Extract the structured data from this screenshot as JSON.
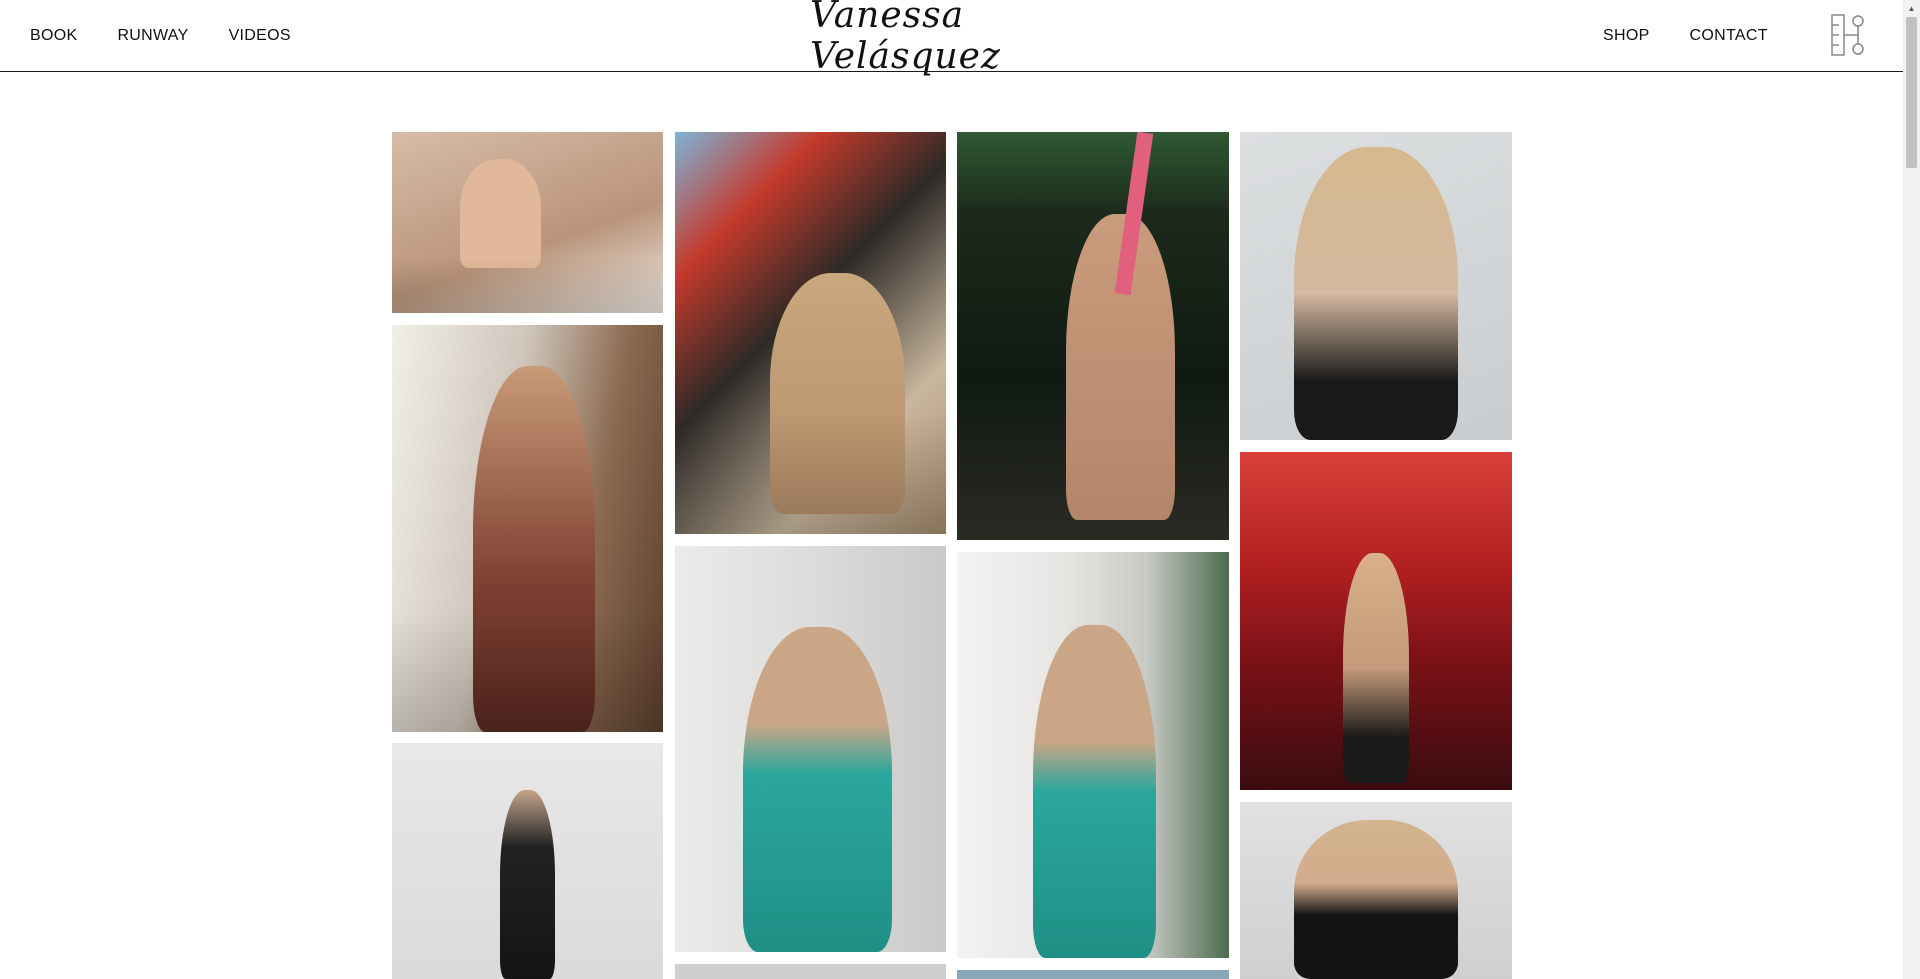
{
  "nav": {
    "left": [
      "BOOK",
      "RUNWAY",
      "VIDEOS"
    ],
    "right": [
      "SHOP",
      "CONTACT"
    ]
  },
  "logo": {
    "text": "Vanessa Velásquez"
  },
  "icons": {
    "menu": "menu-icon"
  },
  "gallery": {
    "colors": {
      "p1": "#c9ab94",
      "p2": "#7a5a45",
      "p3": "#e0dbd6",
      "p4": "#8f7a63",
      "p5": "#bfc3c2",
      "p6": "#213320",
      "p7": "#ece9e6",
      "p8": "#d9dbdb",
      "p9": "#a8161b",
      "p10": "#cfcfcf"
    }
  }
}
